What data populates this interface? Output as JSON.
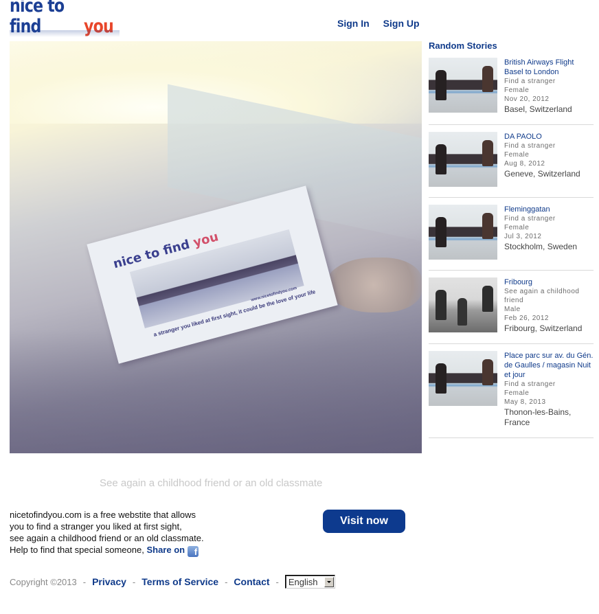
{
  "header": {
    "logo": {
      "part1": "nice to find",
      "part2": "you"
    },
    "nav": [
      {
        "label": "Sign In"
      },
      {
        "label": "Sign Up"
      }
    ]
  },
  "hero": {
    "card_logo_part1": "nice to find",
    "card_logo_part2": "you",
    "card_text": "a stranger you liked at first sight, it could be the love of your life",
    "card_url": "www.nicetofindyou.com"
  },
  "tagline": "See again a childhood friend or an old classmate",
  "description": {
    "lines": [
      "nicetofindyou.com is a free webstite that allows",
      "you to find a stranger you liked at first sight,",
      "see again a childhood friend or an old classmate.",
      "Help to find that special someone,"
    ],
    "share_label": "Share on",
    "facebook_icon_glyph": "f"
  },
  "visit_button": "Visit now",
  "footer": {
    "copyright": "Copyright ©2013",
    "separator": "-",
    "links": [
      {
        "label": "Privacy"
      },
      {
        "label": "Terms of Service"
      },
      {
        "label": "Contact"
      }
    ],
    "language": "English"
  },
  "sidebar": {
    "title": "Random Stories",
    "stories": [
      {
        "title": "British Airways Flight Basel to London",
        "category": "Find a stranger",
        "gender": "Female",
        "date": "Nov 20, 2012",
        "location": "Basel, Switzerland"
      },
      {
        "title": "DA PAOLO",
        "category": "Find a stranger",
        "gender": "Female",
        "date": "Aug 8, 2012",
        "location": "Geneve, Switzerland"
      },
      {
        "title": "Fleminggatan",
        "category": "Find a stranger",
        "gender": "Female",
        "date": "Jul 3, 2012",
        "location": "Stockholm, Sweden"
      },
      {
        "title": "Fribourg",
        "category": "See again a childhood friend",
        "gender": "Male",
        "date": "Feb 26, 2012",
        "location": "Fribourg, Switzerland"
      },
      {
        "title": "Place parc sur av. du Gén. de Gaulles / magasin Nuit et jour",
        "category": "Find a stranger",
        "gender": "Female",
        "date": "May 8, 2013",
        "location": "Thonon-les-Bains, France"
      }
    ]
  }
}
